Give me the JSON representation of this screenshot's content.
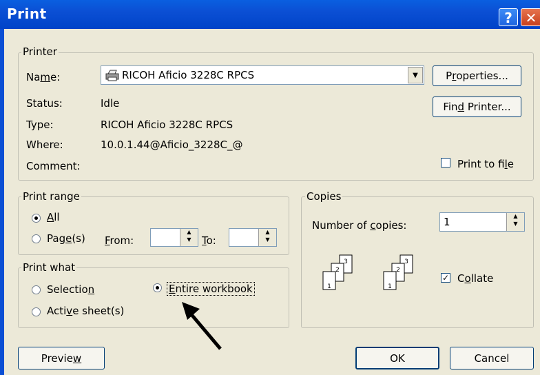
{
  "window": {
    "title": "Print",
    "help_glyph": "?",
    "close_glyph": "✕"
  },
  "printer": {
    "legend": "Printer",
    "name_label": "Name:",
    "name_value": "RICOH Aficio 3228C RPCS",
    "status_label": "Status:",
    "status_value": "Idle",
    "type_label": "Type:",
    "type_value": "RICOH Aficio 3228C RPCS",
    "where_label": "Where:",
    "where_value": "10.0.1.44@Aficio_3228C_@",
    "comment_label": "Comment:",
    "properties_button": "Properties...",
    "find_printer_button": "Find Printer...",
    "print_to_file_label": "Print to file",
    "print_to_file_checked": false
  },
  "print_range": {
    "legend": "Print range",
    "all_label": "All",
    "pages_label": "Page(s)",
    "from_label": "From:",
    "to_label": "To:",
    "from_value": "",
    "to_value": "",
    "selected": "all"
  },
  "print_what": {
    "legend": "Print what",
    "selection_label": "Selection",
    "entire_workbook_label": "Entire workbook",
    "active_sheets_label": "Active sheet(s)",
    "selected": "entire_workbook"
  },
  "copies": {
    "legend": "Copies",
    "number_label": "Number of copies:",
    "number_value": "1",
    "collate_label": "Collate",
    "collate_checked": true
  },
  "footer": {
    "preview_button": "Preview",
    "ok_button": "OK",
    "cancel_button": "Cancel"
  }
}
